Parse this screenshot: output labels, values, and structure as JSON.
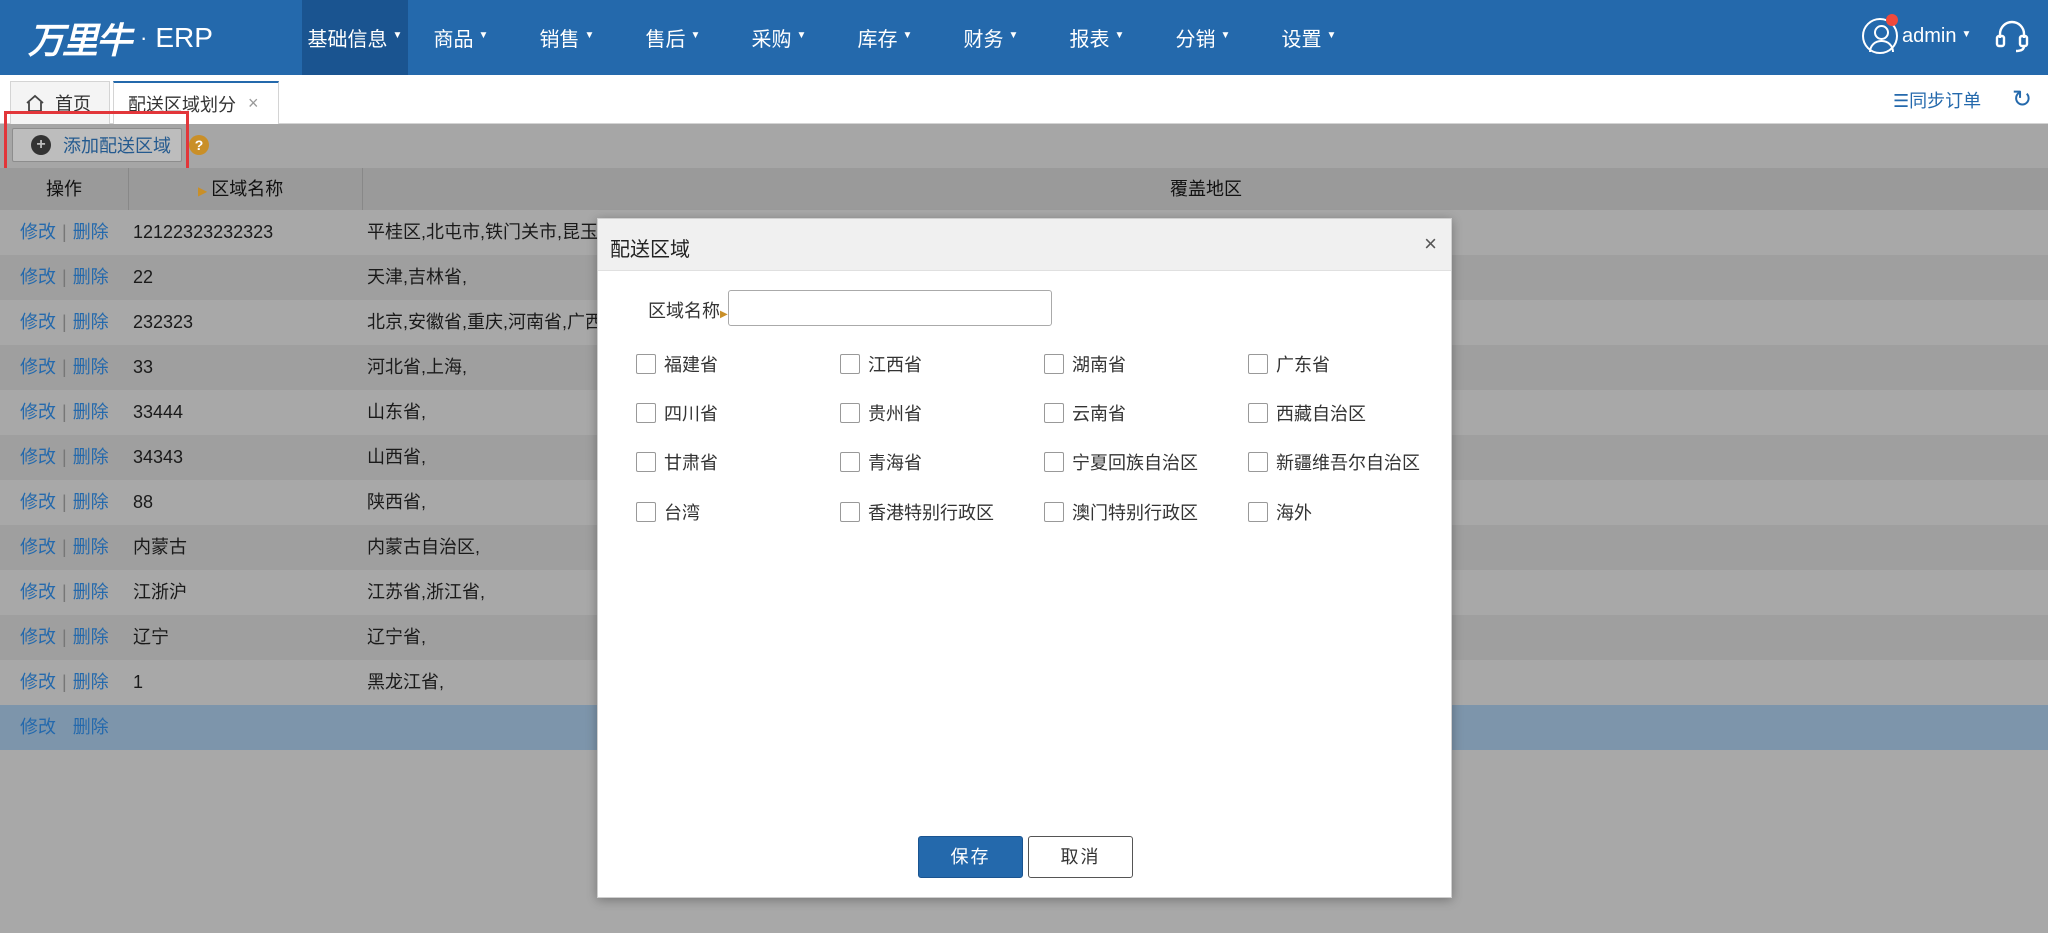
{
  "header": {
    "logo_mark": "万里牛",
    "logo_dot": "·",
    "logo_erp": "ERP",
    "nav": [
      {
        "label": "基础信息"
      },
      {
        "label": "商品"
      },
      {
        "label": "销售"
      },
      {
        "label": "售后"
      },
      {
        "label": "采购"
      },
      {
        "label": "库存"
      },
      {
        "label": "财务"
      },
      {
        "label": "报表"
      },
      {
        "label": "分销"
      },
      {
        "label": "设置"
      }
    ],
    "active_nav": "基础信息",
    "user": "admin"
  },
  "tabs": {
    "home": "首页",
    "current": "配送区域划分",
    "close": "×",
    "sync": "☰同步订单",
    "refresh": "↻"
  },
  "toolbar": {
    "add_label": "添加配送区域",
    "add_icon": "+",
    "help_icon": "?"
  },
  "grid": {
    "headers": {
      "action": "操作",
      "name": "区域名称",
      "coverage": "覆盖地区"
    },
    "edit": "修改",
    "sep": "|",
    "delete": "删除",
    "rows": [
      {
        "name": "12122323232323",
        "coverage": "平桂区,北屯市,铁门关市,昆玉"
      },
      {
        "name": "22",
        "coverage": "天津,吉林省,"
      },
      {
        "name": "232323",
        "coverage": "北京,安徽省,重庆,河南省,广西"
      },
      {
        "name": "33",
        "coverage": "河北省,上海,"
      },
      {
        "name": "33444",
        "coverage": "山东省,"
      },
      {
        "name": "34343",
        "coverage": "山西省,"
      },
      {
        "name": "88",
        "coverage": "陕西省,"
      },
      {
        "name": "内蒙古",
        "coverage": "内蒙古自治区,"
      },
      {
        "name": "江浙沪",
        "coverage": "江苏省,浙江省,"
      },
      {
        "name": "辽宁",
        "coverage": "辽宁省,"
      },
      {
        "name": "1",
        "coverage": "黑龙江省,"
      },
      {
        "name": "",
        "coverage": ""
      }
    ]
  },
  "dialog": {
    "title": "配送区域",
    "close": "×",
    "name_label": "区域名称",
    "name_value": "",
    "provinces": [
      "福建省",
      "江西省",
      "湖南省",
      "广东省",
      "四川省",
      "贵州省",
      "云南省",
      "西藏自治区",
      "甘肃省",
      "青海省",
      "宁夏回族自治区",
      "新疆维吾尔自治区",
      "台湾",
      "香港特别行政区",
      "澳门特别行政区",
      "海外"
    ],
    "save": "保存",
    "cancel": "取消"
  },
  "colors": {
    "brand": "#2469ac",
    "highlight": "#e2363a",
    "notify": "#f04a3c"
  }
}
